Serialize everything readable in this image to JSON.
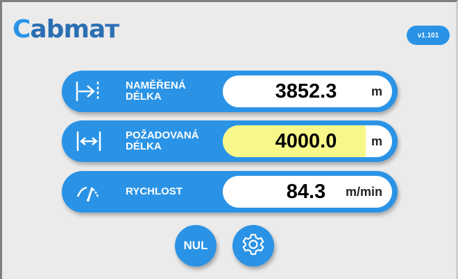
{
  "header": {
    "logo_text": "CabMAT",
    "version": "v1.101"
  },
  "rows": [
    {
      "label_line1": "NAMĚŘENÁ",
      "label_line2": "DÉLKA",
      "value": "3852.3",
      "unit": "m",
      "icon": "measured-length-icon",
      "highlight": false
    },
    {
      "label_line1": "POŽADOVANÁ",
      "label_line2": "DÉLKA",
      "value": "4000.0",
      "unit": "m",
      "icon": "target-length-icon",
      "highlight": true
    },
    {
      "label_line1": "RYCHLOST",
      "label_line2": "",
      "value": "84.3",
      "unit": "m/min",
      "icon": "speedometer-icon",
      "highlight": false
    }
  ],
  "buttons": {
    "reset_label": "NUL",
    "settings_icon": "gear-icon"
  },
  "colors": {
    "accent": "#2a93e6",
    "highlight": "#f8f88a",
    "background": "#ebebeb"
  }
}
